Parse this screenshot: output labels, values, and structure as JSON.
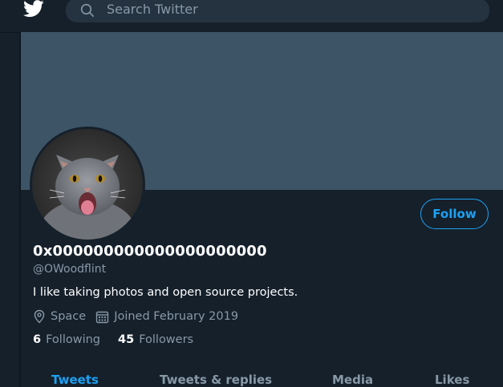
{
  "header": {
    "logo_icon": "twitter-bird-icon",
    "search": {
      "placeholder": "Search Twitter",
      "icon": "search-icon"
    }
  },
  "profile": {
    "display_name": "0x000000000000000000000",
    "handle": "@OWoodflint",
    "bio": "I like taking photos and open source projects.",
    "location": "Space",
    "joined": "Joined February 2019",
    "following_count": "6",
    "following_label": "Following",
    "followers_count": "45",
    "followers_label": "Followers",
    "follow_button": "Follow",
    "avatar": "cat-avatar"
  },
  "tabs": [
    {
      "label": "Tweets",
      "active": true
    },
    {
      "label": "Tweets & replies",
      "active": false
    },
    {
      "label": "Media",
      "active": false
    },
    {
      "label": "Likes",
      "active": false
    }
  ],
  "colors": {
    "background": "#15202b",
    "banner": "#3d5466",
    "accent": "#1da1f2",
    "muted": "#8899a6",
    "search_bg": "#253341"
  }
}
